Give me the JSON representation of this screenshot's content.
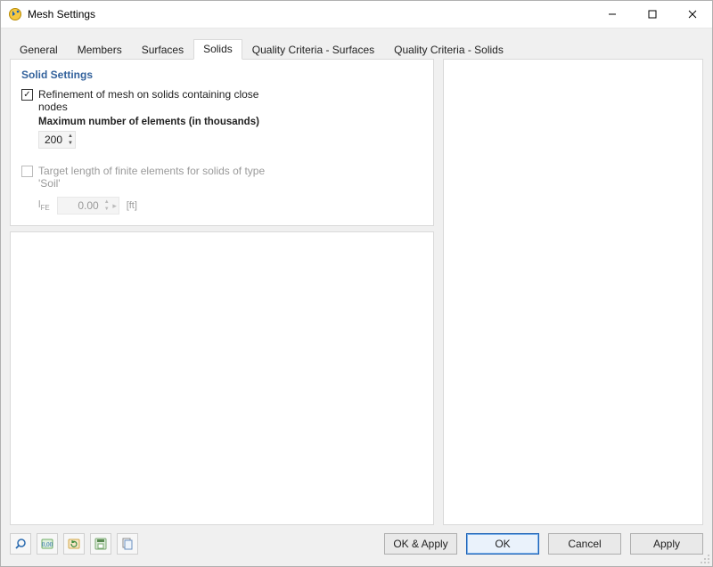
{
  "window": {
    "title": "Mesh Settings"
  },
  "tabs": {
    "general": "General",
    "members": "Members",
    "surfaces": "Surfaces",
    "solids": "Solids",
    "qc_surfaces": "Quality Criteria - Surfaces",
    "qc_solids": "Quality Criteria - Solids",
    "active": "solids"
  },
  "panel": {
    "title": "Solid Settings",
    "refinement": {
      "checked": true,
      "label": "Refinement of mesh on solids containing close nodes",
      "max_label": "Maximum number of elements (in thousands)",
      "max_value": "200"
    },
    "target_soil": {
      "enabled": false,
      "checked": false,
      "label": "Target length of finite elements for solids of type 'Soil'",
      "lfe_symbol": "l",
      "lfe_sub": "FE",
      "value": "0.00",
      "unit": "[ft]"
    }
  },
  "buttons": {
    "ok_apply": "OK & Apply",
    "ok": "OK",
    "cancel": "Cancel",
    "apply": "Apply"
  },
  "icons": {
    "app": "app-icon",
    "minimize": "—",
    "maximize": "☐",
    "close": "✕",
    "check": "✓",
    "tool_search": "search-icon",
    "tool_decimals": "decimals-icon",
    "tool_refresh": "refresh-icon",
    "tool_save": "save-template-icon",
    "tool_copy": "copy-template-icon"
  }
}
